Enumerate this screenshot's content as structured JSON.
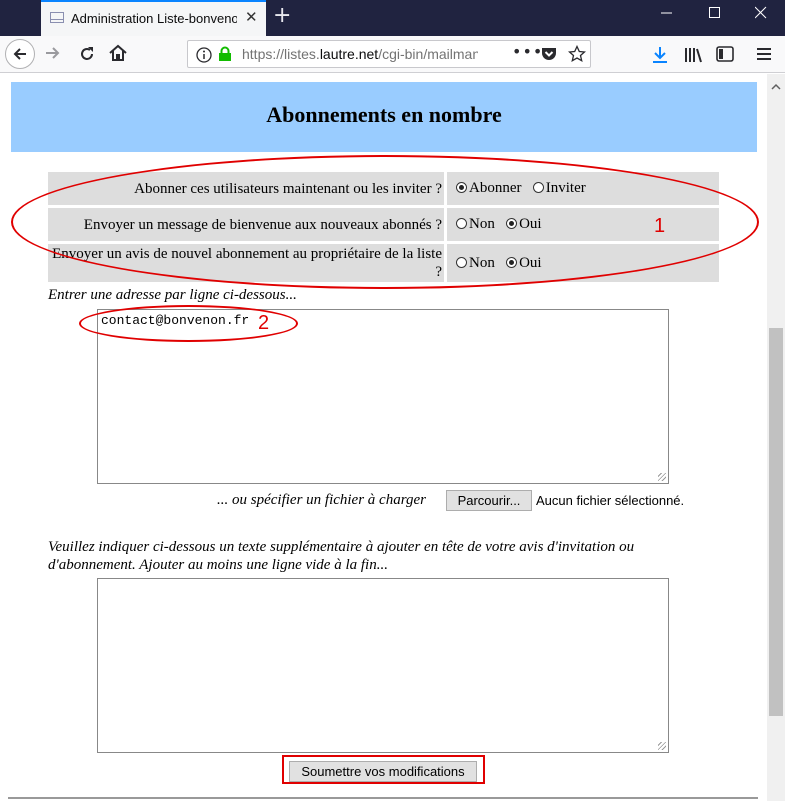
{
  "browser": {
    "tab_title": "Administration Liste-bonvenon",
    "tab_close": "✕",
    "new_tab": "+",
    "url_prefix": "https://listes.",
    "url_domain": "lautre.net",
    "url_path": "/cgi-bin/mailman/admin/liste-bonvenon/members/add",
    "icons": [
      "mail-icon",
      "back-icon",
      "forward-icon",
      "reload-icon",
      "home-icon",
      "info-icon",
      "lock-icon",
      "more-icon",
      "pocket-icon",
      "star-icon",
      "download-icon",
      "library-icon",
      "sidebar-icon",
      "menu-icon",
      "minimize-icon",
      "maximize-icon",
      "close-icon"
    ]
  },
  "page": {
    "title": "Abonnements en nombre",
    "options": [
      {
        "question": "Abonner ces utilisateurs maintenant ou les inviter ?",
        "choices": [
          "Abonner",
          "Inviter"
        ],
        "selected": "Abonner"
      },
      {
        "question": "Envoyer un message de bienvenue aux nouveaux abonnés ?",
        "choices": [
          "Non",
          "Oui"
        ],
        "selected": "Oui"
      },
      {
        "question": "Envoyer un avis de nouvel abonnement au propriétaire de la liste ?",
        "choices": [
          "Non",
          "Oui"
        ],
        "selected": "Oui"
      }
    ],
    "address_label": "Entrer une adresse par ligne ci-dessous...",
    "address_value": "contact@bonvenon.fr",
    "file_label": "... ou spécifier un fichier à charger",
    "browse_button": "Parcourir...",
    "no_file": "Aucun fichier sélectionné.",
    "invite_text_label": "Veuillez indiquer ci-dessous un texte supplémentaire à ajouter en tête de votre avis d'invitation ou d'abonnement. Ajouter au moins une ligne vide à la fin...",
    "invite_text_value": "",
    "submit_button": "Soumettre vos modifications"
  },
  "annotations": {
    "label_1": "1",
    "label_2": "2",
    "color": "#e00000"
  },
  "colors": {
    "header_bg": "#99ccff",
    "row_bg": "#dddddd",
    "titlebar": "#202340",
    "accent": "#0a84ff"
  }
}
